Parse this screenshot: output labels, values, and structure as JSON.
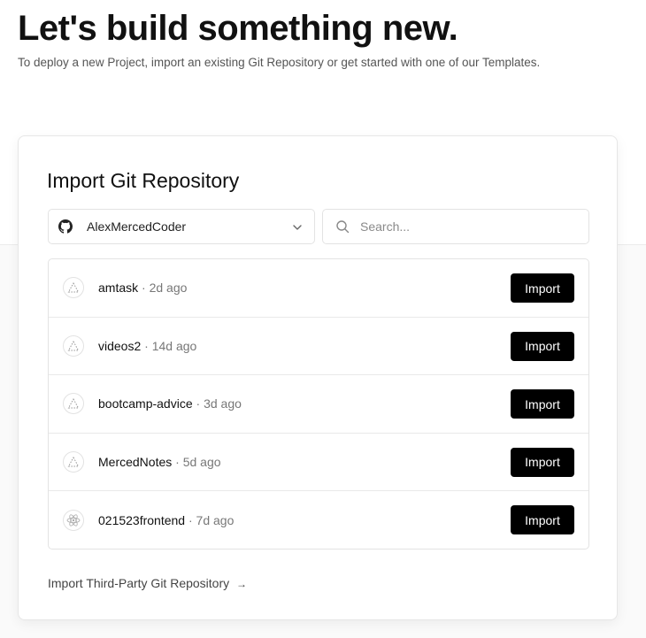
{
  "hero": {
    "title": "Let's build something new.",
    "subtitle": "To deploy a new Project, import an existing Git Repository or get started with one of our Templates."
  },
  "import_card": {
    "title": "Import Git Repository",
    "account": {
      "name": "AlexMercedCoder",
      "icon": "github-icon"
    },
    "search": {
      "placeholder": "Search...",
      "value": ""
    },
    "repos": [
      {
        "name": "amtask",
        "separator": "·",
        "age": "2d ago",
        "icon": "triangle-icon",
        "button": "Import"
      },
      {
        "name": "videos2",
        "separator": "·",
        "age": "14d ago",
        "icon": "triangle-icon",
        "button": "Import"
      },
      {
        "name": "bootcamp-advice",
        "separator": "·",
        "age": "3d ago",
        "icon": "triangle-icon",
        "button": "Import"
      },
      {
        "name": "MercedNotes",
        "separator": "·",
        "age": "5d ago",
        "icon": "triangle-icon",
        "button": "Import"
      },
      {
        "name": "021523frontend",
        "separator": "·",
        "age": "7d ago",
        "icon": "react-icon",
        "button": "Import"
      }
    ],
    "third_party": {
      "label": "Import Third-Party Git Repository",
      "arrow": "→"
    }
  },
  "colors": {
    "button_bg": "#000000",
    "button_text": "#ffffff",
    "border": "#e3e3e3",
    "muted_text": "#777777"
  }
}
